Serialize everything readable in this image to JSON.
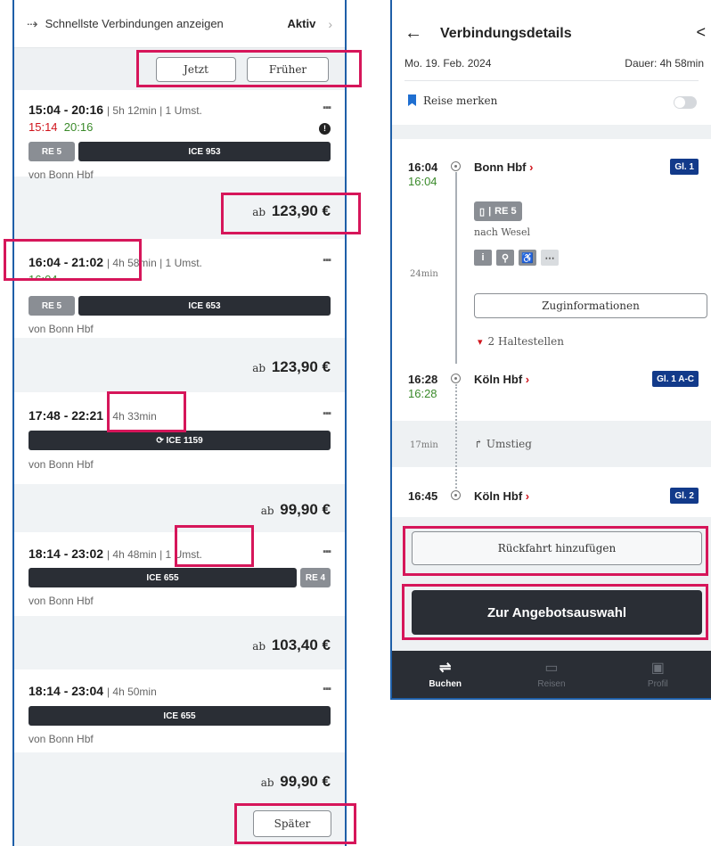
{
  "left": {
    "fast_label": "Schnellste Verbindungen anzeigen",
    "fast_state": "Aktiv",
    "btn_now": "Jetzt",
    "btn_earlier": "Früher",
    "btn_later": "Später",
    "price_prefix": "ab",
    "origin": "von Bonn Hbf",
    "conn": [
      {
        "time": "15:04 - 20:16",
        "meta": "| 5h 12min | 1 Umst.",
        "rt1": "15:14",
        "rt2": "20:16",
        "trains": [
          "RE 5",
          "ICE 953"
        ],
        "price": "123,90 €"
      },
      {
        "time": "16:04 - 21:02",
        "meta": "| 4h 58min | 1 Umst.",
        "rt2": "16:04",
        "trains": [
          "RE 5",
          "ICE 653"
        ],
        "price": "123,90 €"
      },
      {
        "time": "17:48 - 22:21",
        "meta": "| 4h 33min",
        "trains": [
          "ICE 1159"
        ],
        "price": "99,90 €"
      },
      {
        "time": "18:14 - 23:02",
        "meta": "| 4h 48min | 1 Umst.",
        "trains": [
          "ICE 655",
          "RE 4"
        ],
        "price": "103,40 €"
      },
      {
        "time": "18:14 - 23:04",
        "meta": "| 4h 50min",
        "trains": [
          "ICE 655"
        ],
        "price": "99,90 €"
      }
    ]
  },
  "right": {
    "title": "Verbindungsdetails",
    "date": "Mo. 19. Feb. 2024",
    "duration": "Dauer: 4h 58min",
    "save_trip": "Reise merken",
    "stop1": {
      "time": "16:04",
      "rt": "16:04",
      "name": "Bonn Hbf",
      "track": "Gl. 1"
    },
    "train": "RE 5",
    "direction": "nach Wesel",
    "ride_mins": "24min",
    "train_info": "Zuginformationen",
    "stops_count": "2 Haltestellen",
    "stop2": {
      "time": "16:28",
      "rt": "16:28",
      "name": "Köln Hbf",
      "track": "Gl. 1 A-C"
    },
    "transfer_mins": "17min",
    "transfer": "Umstieg",
    "stop3": {
      "time": "16:45",
      "name": "Köln Hbf",
      "track": "Gl. 2"
    },
    "return_btn": "Rückfahrt hinzufügen",
    "offer_btn": "Zur Angebotsauswahl",
    "nav": [
      "Buchen",
      "Reisen",
      "Profil"
    ]
  },
  "colors": {
    "highlight": "#d6165a",
    "delay": "#d0141c",
    "ontime": "#3a8a2a",
    "track": "#123a8a",
    "dark": "#2a2e35"
  }
}
